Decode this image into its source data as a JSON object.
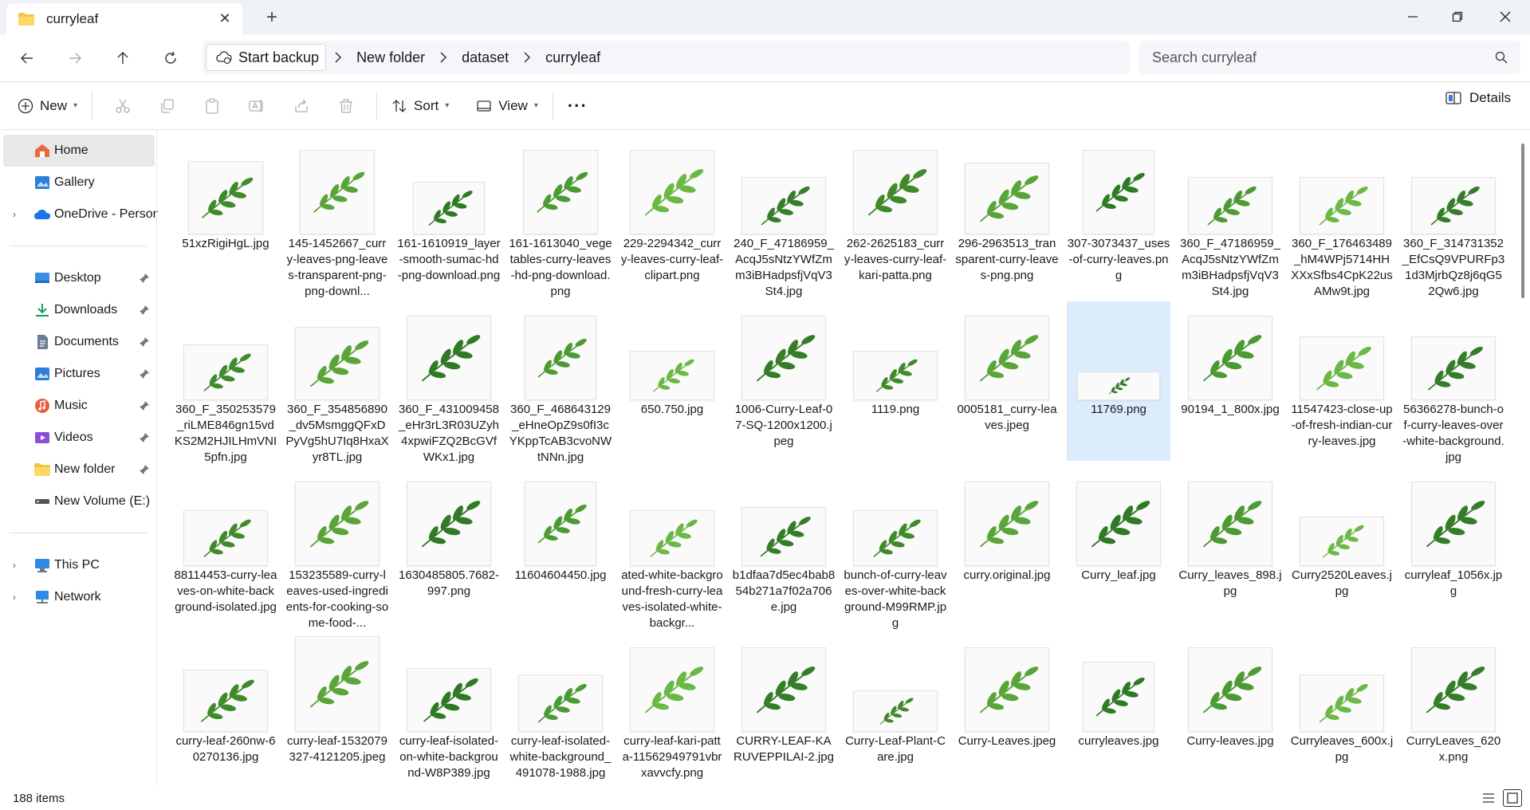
{
  "window": {
    "tab_title": "curryleaf",
    "new_tab": "+",
    "close_tab": "✕"
  },
  "address": {
    "backup_label": "Start backup",
    "crumbs": [
      "New folder",
      "dataset",
      "curryleaf"
    ]
  },
  "search": {
    "placeholder": "Search curryleaf"
  },
  "toolbar": {
    "new_label": "New",
    "sort_label": "Sort",
    "view_label": "View",
    "more_label": "···",
    "details_label": "Details"
  },
  "sidebar": {
    "items": [
      {
        "label": "Home",
        "icon": "home-icon"
      },
      {
        "label": "Gallery",
        "icon": "gallery-icon"
      },
      {
        "label": "OneDrive - Persona",
        "icon": "cloud-icon"
      },
      {
        "label": "Desktop",
        "icon": "desktop-icon"
      },
      {
        "label": "Downloads",
        "icon": "download-icon"
      },
      {
        "label": "Documents",
        "icon": "documents-icon"
      },
      {
        "label": "Pictures",
        "icon": "pictures-icon"
      },
      {
        "label": "Music",
        "icon": "music-icon"
      },
      {
        "label": "Videos",
        "icon": "videos-icon"
      },
      {
        "label": "New folder",
        "icon": "folder-icon"
      },
      {
        "label": "New Volume (E:)",
        "icon": "drive-icon"
      },
      {
        "label": "This PC",
        "icon": "pc-icon"
      },
      {
        "label": "Network",
        "icon": "network-icon"
      }
    ]
  },
  "files": [
    "51xzRigiHgL.jpg",
    "145-1452667_curry-leaves-png-leaves-transparent-png-png-downl...",
    "161-1610919_layer-smooth-sumac-hd-png-download.png",
    "161-1613040_vegetables-curry-leaves-hd-png-download.png",
    "229-2294342_curry-leaves-curry-leaf-clipart.png",
    "240_F_47186959_AcqJ5sNtzYWfZmm3iBHadpsfjVqV3St4.jpg",
    "262-2625183_curry-leaves-curry-leaf-kari-patta.png",
    "296-2963513_transparent-curry-leaves-png.png",
    "307-3073437_uses-of-curry-leaves.png",
    "360_F_47186959_AcqJ5sNtzYWfZmm3iBHadpsfjVqV3St4.jpg",
    "360_F_176463489_hM4WPj5714HHXXxSfbs4CpK22usAMw9t.jpg",
    "360_F_314731352_EfCsQ9VPURFp31d3MjrbQz8j6qG52Qw6.jpg",
    "360_F_350253579_riLME846gn15vdKS2M2HJILHmVNI5pfn.jpg",
    "360_F_354856890_dv5MsmggQFxDPyVg5hU7Iq8HxaXyr8TL.jpg",
    "360_F_431009458_eHr3rL3R03UZyh4xpwiFZQ2BcGVfWKx1.jpg",
    "360_F_468643129_eHneOpZ9s0fI3cYKppTcAB3cvoNWtNNn.jpg",
    "650.750.jpg",
    "1006-Curry-Leaf-07-SQ-1200x1200.jpeg",
    "1119.png",
    "0005181_curry-leaves.jpeg",
    "11769.png",
    "90194_1_800x.jpg",
    "11547423-close-up-of-fresh-indian-curry-leaves.jpg",
    "56366278-bunch-of-curry-leaves-over-white-background.jpg",
    "88114453-curry-leaves-on-white-background-isolated.jpg",
    "153235589-curry-leaves-used-ingredients-for-cooking-some-food-...",
    "1630485805.7682-997.png",
    "11604604450.jpg",
    "ated-white-background-fresh-curry-leaves-isolated-white-backgr...",
    "b1dfaa7d5ec4bab854b271a7f02a706e.jpg",
    "bunch-of-curry-leaves-over-white-background-M99RMP.jpg",
    "curry.original.jpg",
    "Curry_leaf.jpg",
    "Curry_leaves_898.jpg",
    "Curry2520Leaves.jpg",
    "curryleaf_1056x.jpg",
    "curry-leaf-260nw-60270136.jpg",
    "curry-leaf-1532079327-4121205.jpeg",
    "curry-leaf-isolated-on-white-background-W8P389.jpg",
    "curry-leaf-isolated-white-background_491078-1988.jpg",
    "curry-leaf-kari-patta-11562949791vbrxavvcfy.png",
    "CURRY-LEAF-KARUVEPPILAI-2.jpg",
    "Curry-Leaf-Plant-Care.jpg",
    "Curry-Leaves.jpeg",
    "curryleaves.jpg",
    "Curry-leaves.jpg",
    "Curryleaves_600x.jpg",
    "CurryLeaves_620x.png"
  ],
  "selected_index": 20,
  "status": {
    "count": "188 items"
  }
}
